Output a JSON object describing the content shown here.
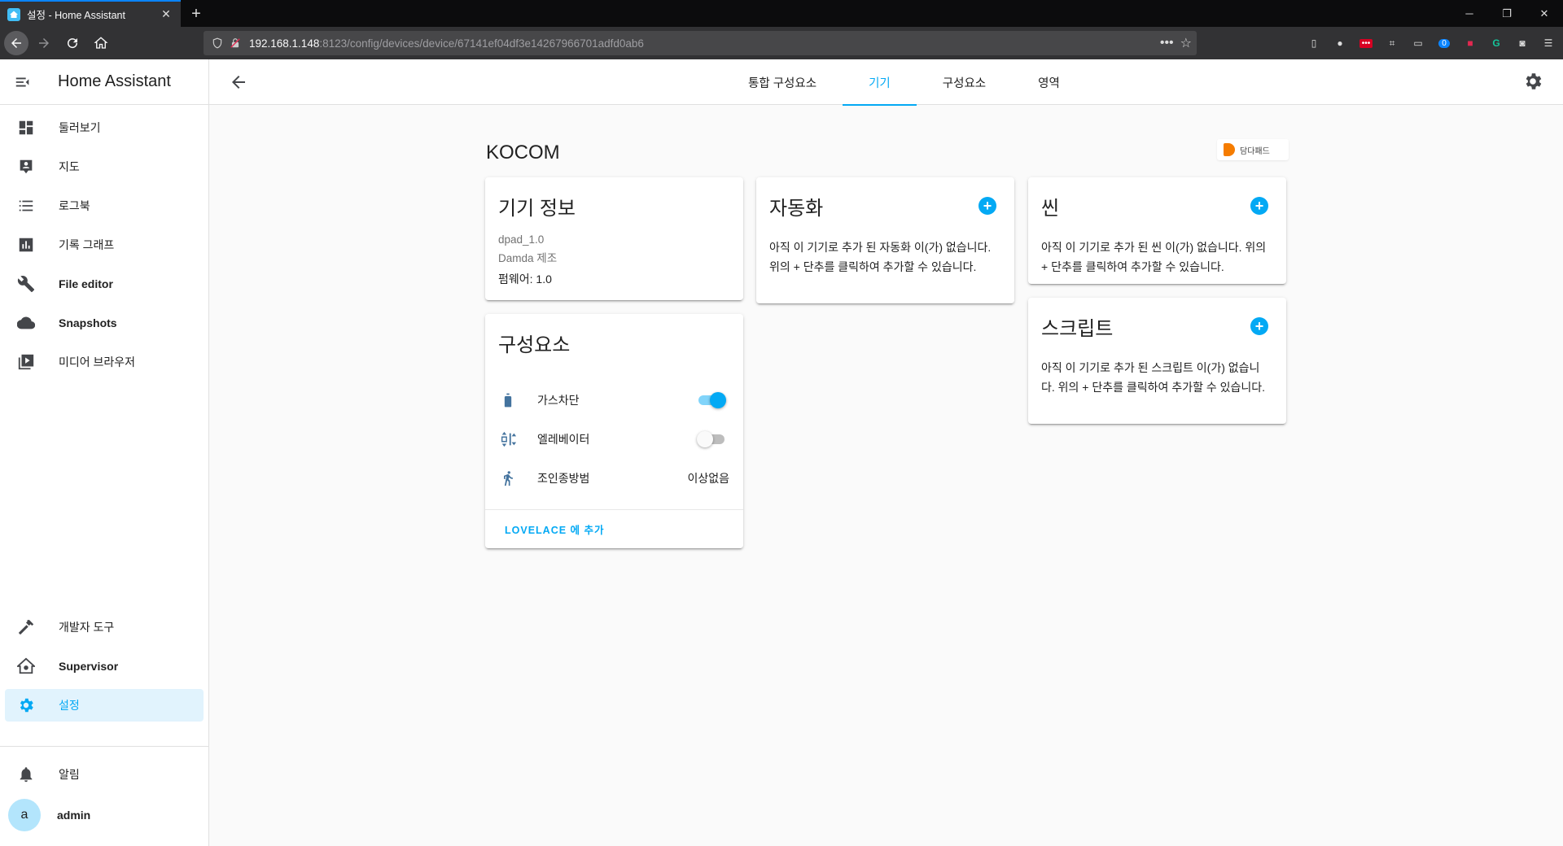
{
  "browser": {
    "tab_title": "설정 - Home Assistant",
    "url_host": "192.168.1.148",
    "url_rest": ":8123/config/devices/device/67141ef04df3e14267966701adfd0ab6",
    "more_glyph": "•••",
    "extension_badge": "0"
  },
  "sidebar": {
    "title": "Home Assistant",
    "items": [
      {
        "label": "둘러보기",
        "icon": "dashboard-icon"
      },
      {
        "label": "지도",
        "icon": "map-icon"
      },
      {
        "label": "로그북",
        "icon": "logbook-icon"
      },
      {
        "label": "기록 그래프",
        "icon": "history-chart-icon"
      },
      {
        "label": "File editor",
        "icon": "wrench-icon"
      },
      {
        "label": "Snapshots",
        "icon": "cloud-icon"
      },
      {
        "label": "미디어 브라우저",
        "icon": "media-icon"
      }
    ],
    "bottom_items": [
      {
        "label": "개발자 도구",
        "icon": "hammer-icon"
      },
      {
        "label": "Supervisor",
        "icon": "supervisor-icon"
      },
      {
        "label": "설정",
        "icon": "gear-icon",
        "active": true
      }
    ],
    "notifications_label": "알림",
    "user": {
      "initial": "a",
      "name": "admin"
    }
  },
  "toolbar": {
    "tabs": [
      {
        "label": "통합 구성요소",
        "active": false
      },
      {
        "label": "기기",
        "active": true
      },
      {
        "label": "구성요소",
        "active": false
      },
      {
        "label": "영역",
        "active": false
      }
    ]
  },
  "device": {
    "name": "KOCOM",
    "brand_label": "담다패드",
    "info": {
      "title": "기기 정보",
      "model": "dpad_1.0",
      "manufacturer": "Damda 제조",
      "firmware": "펌웨어: 1.0"
    },
    "entities": {
      "title": "구성요소",
      "rows": [
        {
          "name": "가스차단",
          "icon": "gas-cylinder-icon",
          "toggle": true,
          "state_on": true
        },
        {
          "name": "엘레베이터",
          "icon": "elevator-icon",
          "toggle": true,
          "state_on": false
        },
        {
          "name": "조인종방범",
          "icon": "walk-icon",
          "toggle": false,
          "state": "이상없음"
        }
      ],
      "action_label": "LOVELACE 에 추가"
    },
    "automation": {
      "title": "자동화",
      "text": "아직 이 기기로 추가 된 자동화 이(가) 없습니다. 위의 + 단추를 클릭하여 추가할 수 있습니다."
    },
    "scene": {
      "title": "씬",
      "text": "아직 이 기기로 추가 된 씬 이(가) 없습니다. 위의 + 단추를 클릭하여 추가할 수 있습니다."
    },
    "script": {
      "title": "스크립트",
      "text": "아직 이 기기로 추가 된 스크립트 이(가) 없습니다. 위의 + 단추를 클릭하여 추가할 수 있습니다."
    }
  },
  "colors": {
    "accent": "#03a9f4",
    "sidebar_active_bg": "#e1f3fd",
    "chrome_dark": "#323234"
  }
}
